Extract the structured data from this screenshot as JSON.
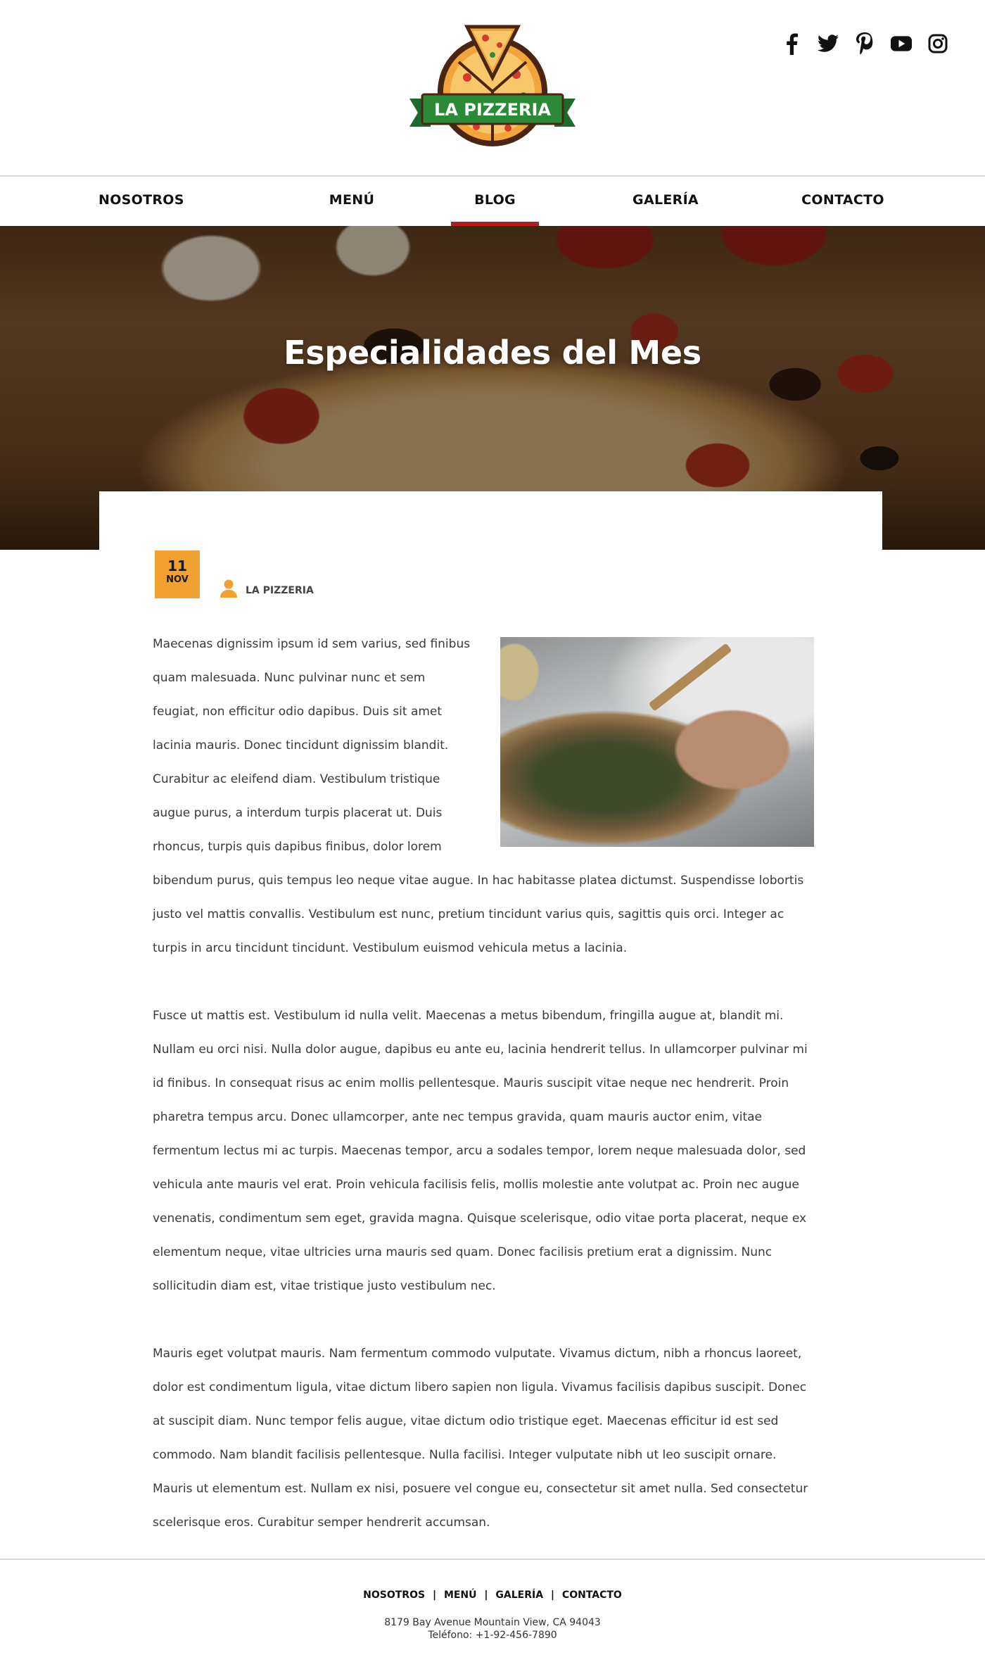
{
  "brand": {
    "logo_text": "LA PIZZERIA"
  },
  "social": [
    {
      "icon": "facebook-icon"
    },
    {
      "icon": "twitter-icon"
    },
    {
      "icon": "pinterest-icon"
    },
    {
      "icon": "youtube-icon"
    },
    {
      "icon": "instagram-icon"
    }
  ],
  "nav": {
    "items": [
      "NOSOTROS",
      "MENÚ",
      "BLOG",
      "GALERÍA",
      "CONTACTO"
    ],
    "active": "BLOG",
    "active_color": "#b51d1d"
  },
  "hero": {
    "title": "Especialidades del Mes"
  },
  "post": {
    "date_day": "11",
    "date_month": "NOV",
    "badge_color": "#f1a130",
    "author_icon": "user-icon",
    "author": "LA PIZZERIA",
    "paragraphs": [
      "Maecenas dignissim ipsum id sem varius, sed finibus quam malesuada. Nunc pulvinar nunc et sem feugiat, non efficitur odio dapibus. Duis sit amet lacinia mauris. Donec tincidunt dignissim blandit. Curabitur ac eleifend diam. Vestibulum tristique augue purus, a interdum turpis placerat ut. Duis rhoncus, turpis quis dapibus finibus, dolor lorem bibendum purus, quis tempus leo neque vitae augue. In hac habitasse platea dictumst. Suspendisse lobortis justo vel mattis convallis. Vestibulum est nunc, pretium tincidunt varius quis, sagittis quis orci. Integer ac turpis in arcu tincidunt tincidunt. Vestibulum euismod vehicula metus a lacinia.",
      "Fusce ut mattis est. Vestibulum id nulla velit. Maecenas a metus bibendum, fringilla augue at, blandit mi. Nullam eu orci nisi. Nulla dolor augue, dapibus eu ante eu, lacinia hendrerit tellus. In ullamcorper pulvinar mi id finibus. In consequat risus ac enim mollis pellentesque. Mauris suscipit vitae neque nec hendrerit. Proin pharetra tempus arcu. Donec ullamcorper, ante nec tempus gravida, quam mauris auctor enim, vitae fermentum lectus mi ac turpis. Maecenas tempor, arcu a sodales tempor, lorem neque malesuada dolor, sed vehicula ante mauris vel erat. Proin vehicula facilisis felis, mollis molestie ante volutpat ac. Proin nec augue venenatis, condimentum sem eget, gravida magna. Quisque scelerisque, odio vitae porta placerat, neque ex elementum neque, vitae ultricies urna mauris sed quam. Donec facilisis pretium erat a dignissim. Nunc sollicitudin diam est, vitae tristique justo vestibulum nec.",
      "Mauris eget volutpat mauris. Nam fermentum commodo vulputate. Vivamus dictum, nibh a rhoncus laoreet, dolor est condimentum ligula, vitae dictum libero sapien non ligula. Vivamus facilisis dapibus suscipit. Donec at suscipit diam. Nunc tempor felis augue, vitae dictum odio tristique eget. Maecenas efficitur id est sed commodo. Nam blandit facilisis pellentesque. Nulla facilisi. Integer vulputate nibh ut leo suscipit ornare. Mauris ut elementum est. Nullam ex nisi, posuere vel congue eu, consectetur sit amet nulla. Sed consectetur scelerisque eros. Curabitur semper hendrerit accumsan."
    ]
  },
  "footer": {
    "links": [
      "NOSOTROS",
      "MENÚ",
      "GALERÍA",
      "CONTACTO"
    ],
    "separator": "|",
    "address": "8179 Bay Avenue  Mountain View, CA 94043",
    "phone": "Teléfono: +1-92-456-7890"
  }
}
